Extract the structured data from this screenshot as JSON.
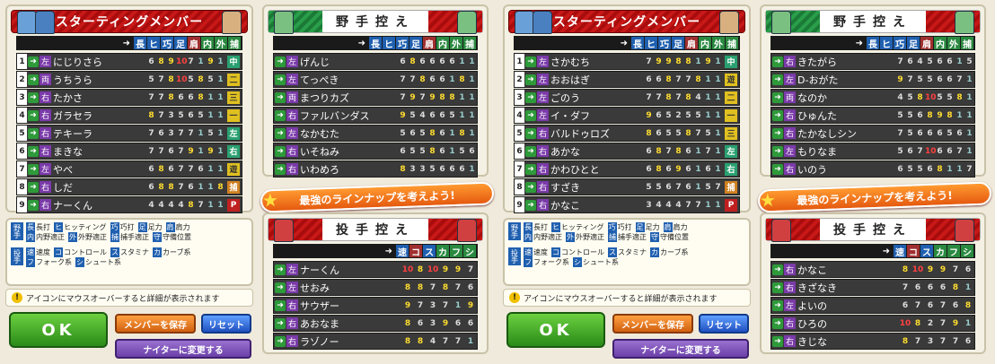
{
  "ui": {
    "starting_title": "スターティングメンバー",
    "fielders_title": "野手控え",
    "pitchers_title": "投手控え",
    "bat_cols": [
      "長",
      "ヒ",
      "巧",
      "足",
      "肩",
      "内",
      "外",
      "捕"
    ],
    "pitch_cols": [
      "速",
      "コ",
      "ス",
      "カ",
      "フ",
      "シ"
    ],
    "banner": "最強のラインナップを考えよう!",
    "note": "アイコンにマウスオーバーすると詳細が表示されます",
    "ok": "OK",
    "save": "メンバーを保存",
    "reset": "リセット",
    "night": "ナイターに変更する",
    "legend_fielder_label": "野手",
    "legend_pitcher_label": "投手",
    "legend_fielder_1": [
      "長",
      "長打",
      "ヒ",
      "ヒッティング",
      "巧",
      "巧打",
      "足",
      "足力",
      "肩",
      "肩力"
    ],
    "legend_fielder_2": [
      "内",
      "内野適正",
      "外",
      "外野適正",
      "捕",
      "捕手適正",
      "守",
      "守備位置"
    ],
    "legend_pitcher_1": [
      "速",
      "速度",
      "コ",
      "コントロール",
      "ス",
      "スタミナ",
      "カ",
      "カーブ系"
    ],
    "legend_pitcher_2": [
      "フ",
      "フォーク系",
      "シ",
      "シュート系"
    ],
    "arrow": "➜"
  },
  "views": [
    {
      "lineup": [
        {
          "n": "1",
          "h": "左",
          "name": "にじりさら",
          "s": [
            "6",
            "8",
            "9",
            "10",
            "7",
            "1",
            "9",
            "1"
          ],
          "pos": "中"
        },
        {
          "n": "2",
          "h": "両",
          "name": "うちうら",
          "s": [
            "5",
            "7",
            "8",
            "10",
            "5",
            "8",
            "5",
            "1"
          ],
          "pos": "二"
        },
        {
          "n": "3",
          "h": "右",
          "name": "たかさ",
          "s": [
            "7",
            "7",
            "8",
            "6",
            "6",
            "8",
            "1",
            "1"
          ],
          "pos": "三"
        },
        {
          "n": "4",
          "h": "右",
          "name": "ガラセラ",
          "s": [
            "8",
            "7",
            "3",
            "5",
            "6",
            "5",
            "1",
            "1"
          ],
          "pos": "一"
        },
        {
          "n": "5",
          "h": "右",
          "name": "テキーラ",
          "s": [
            "7",
            "6",
            "3",
            "7",
            "7",
            "1",
            "5",
            "1"
          ],
          "pos": "左"
        },
        {
          "n": "6",
          "h": "右",
          "name": "まきな",
          "s": [
            "7",
            "7",
            "6",
            "7",
            "9",
            "1",
            "9",
            "1"
          ],
          "pos": "右"
        },
        {
          "n": "7",
          "h": "左",
          "name": "やべ",
          "s": [
            "6",
            "8",
            "6",
            "7",
            "7",
            "6",
            "1",
            "1"
          ],
          "pos": "遊"
        },
        {
          "n": "8",
          "h": "右",
          "name": "しだ",
          "s": [
            "6",
            "8",
            "8",
            "7",
            "6",
            "1",
            "1",
            "8"
          ],
          "pos": "捕"
        },
        {
          "n": "9",
          "h": "右",
          "name": "ナーくん",
          "s": [
            "4",
            "4",
            "4",
            "4",
            "8",
            "7",
            "1",
            "1"
          ],
          "pos": "P"
        }
      ],
      "fielders": [
        {
          "h": "左",
          "name": "げんじ",
          "s": [
            "6",
            "8",
            "6",
            "6",
            "6",
            "6",
            "1",
            "1"
          ]
        },
        {
          "h": "左",
          "name": "てっぺき",
          "s": [
            "7",
            "7",
            "8",
            "6",
            "6",
            "1",
            "8",
            "1"
          ]
        },
        {
          "h": "両",
          "name": "まつりカズ",
          "s": [
            "7",
            "9",
            "7",
            "9",
            "8",
            "8",
            "1",
            "1"
          ]
        },
        {
          "h": "右",
          "name": "ファルバンダス",
          "s": [
            "9",
            "5",
            "4",
            "6",
            "6",
            "5",
            "1",
            "1"
          ]
        },
        {
          "h": "左",
          "name": "なかむた",
          "s": [
            "5",
            "6",
            "5",
            "8",
            "6",
            "1",
            "8",
            "1"
          ]
        },
        {
          "h": "右",
          "name": "いそねみ",
          "s": [
            "6",
            "5",
            "5",
            "8",
            "6",
            "1",
            "5",
            "6"
          ]
        },
        {
          "h": "右",
          "name": "いわめろ",
          "s": [
            "8",
            "3",
            "3",
            "5",
            "6",
            "6",
            "6",
            "1"
          ]
        }
      ],
      "pitchers": [
        {
          "h": "左",
          "name": "ナーくん",
          "s": [
            "10",
            "8",
            "10",
            "9",
            "9",
            "7"
          ]
        },
        {
          "h": "左",
          "name": "せおみ",
          "s": [
            "8",
            "8",
            "7",
            "8",
            "7",
            "6"
          ]
        },
        {
          "h": "右",
          "name": "サウザー",
          "s": [
            "9",
            "7",
            "3",
            "7",
            "1",
            "9"
          ]
        },
        {
          "h": "右",
          "name": "あおなま",
          "s": [
            "8",
            "6",
            "3",
            "9",
            "6",
            "6"
          ]
        },
        {
          "h": "右",
          "name": "ラゾノー",
          "s": [
            "8",
            "8",
            "4",
            "7",
            "7",
            "1"
          ]
        }
      ]
    },
    {
      "lineup": [
        {
          "n": "1",
          "h": "左",
          "name": "さかむち",
          "s": [
            "7",
            "9",
            "9",
            "8",
            "8",
            "1",
            "9",
            "1"
          ],
          "pos": "中"
        },
        {
          "n": "2",
          "h": "左",
          "name": "おおはぎ",
          "s": [
            "6",
            "6",
            "8",
            "7",
            "7",
            "8",
            "1",
            "1"
          ],
          "pos": "遊"
        },
        {
          "n": "3",
          "h": "左",
          "name": "ごのう",
          "s": [
            "7",
            "7",
            "8",
            "7",
            "8",
            "4",
            "1",
            "1"
          ],
          "pos": "二"
        },
        {
          "n": "4",
          "h": "左",
          "name": "イ・ダフ",
          "s": [
            "9",
            "6",
            "5",
            "2",
            "5",
            "5",
            "1",
            "1"
          ],
          "pos": "一"
        },
        {
          "n": "5",
          "h": "右",
          "name": "バルドゥロズ",
          "s": [
            "8",
            "6",
            "5",
            "5",
            "8",
            "7",
            "5",
            "1"
          ],
          "pos": "三"
        },
        {
          "n": "6",
          "h": "右",
          "name": "あかな",
          "s": [
            "6",
            "8",
            "7",
            "8",
            "6",
            "1",
            "7",
            "1"
          ],
          "pos": "左"
        },
        {
          "n": "7",
          "h": "右",
          "name": "かわひとと",
          "s": [
            "6",
            "8",
            "6",
            "9",
            "6",
            "1",
            "6",
            "1"
          ],
          "pos": "右"
        },
        {
          "n": "8",
          "h": "右",
          "name": "すざき",
          "s": [
            "5",
            "5",
            "6",
            "7",
            "6",
            "1",
            "5",
            "7"
          ],
          "pos": "捕"
        },
        {
          "n": "9",
          "h": "右",
          "name": "かなこ",
          "s": [
            "3",
            "4",
            "4",
            "4",
            "7",
            "7",
            "1",
            "1"
          ],
          "pos": "P"
        }
      ],
      "fielders": [
        {
          "h": "右",
          "name": "きたがら",
          "s": [
            "7",
            "6",
            "4",
            "5",
            "6",
            "6",
            "1",
            "5"
          ]
        },
        {
          "h": "左",
          "name": "D-おがた",
          "s": [
            "9",
            "7",
            "5",
            "5",
            "6",
            "6",
            "7",
            "1"
          ]
        },
        {
          "h": "両",
          "name": "なのか",
          "s": [
            "4",
            "5",
            "8",
            "10",
            "5",
            "5",
            "8",
            "1"
          ]
        },
        {
          "h": "右",
          "name": "ひゅんた",
          "s": [
            "5",
            "5",
            "6",
            "8",
            "9",
            "8",
            "1",
            "1"
          ]
        },
        {
          "h": "右",
          "name": "たかなしシン",
          "s": [
            "7",
            "5",
            "6",
            "6",
            "6",
            "5",
            "6",
            "1"
          ]
        },
        {
          "h": "左",
          "name": "もりなま",
          "s": [
            "5",
            "6",
            "7",
            "10",
            "6",
            "6",
            "7",
            "1"
          ]
        },
        {
          "h": "右",
          "name": "いのう",
          "s": [
            "6",
            "5",
            "5",
            "6",
            "8",
            "1",
            "1",
            "7"
          ]
        }
      ],
      "pitchers": [
        {
          "h": "右",
          "name": "かなこ",
          "s": [
            "8",
            "10",
            "9",
            "9",
            "7",
            "6"
          ]
        },
        {
          "h": "右",
          "name": "きざなき",
          "s": [
            "7",
            "6",
            "6",
            "6",
            "8",
            "1"
          ]
        },
        {
          "h": "左",
          "name": "よいの",
          "s": [
            "6",
            "7",
            "6",
            "7",
            "6",
            "8"
          ]
        },
        {
          "h": "右",
          "name": "ひろの",
          "s": [
            "10",
            "8",
            "2",
            "7",
            "9",
            "1"
          ]
        },
        {
          "h": "右",
          "name": "きじな",
          "s": [
            "8",
            "7",
            "3",
            "7",
            "7",
            "6"
          ]
        }
      ]
    }
  ],
  "colors": {
    "cols": [
      "#2060b0",
      "#2060b0",
      "#2060b0",
      "#2060b0",
      "#a03030",
      "#2a8a40",
      "#2a8a40",
      "#2a8a40"
    ],
    "pcols": [
      "#2060b0",
      "#a03030",
      "#2060b0",
      "#2a8a40",
      "#2a8a40",
      "#2a8a40"
    ]
  }
}
